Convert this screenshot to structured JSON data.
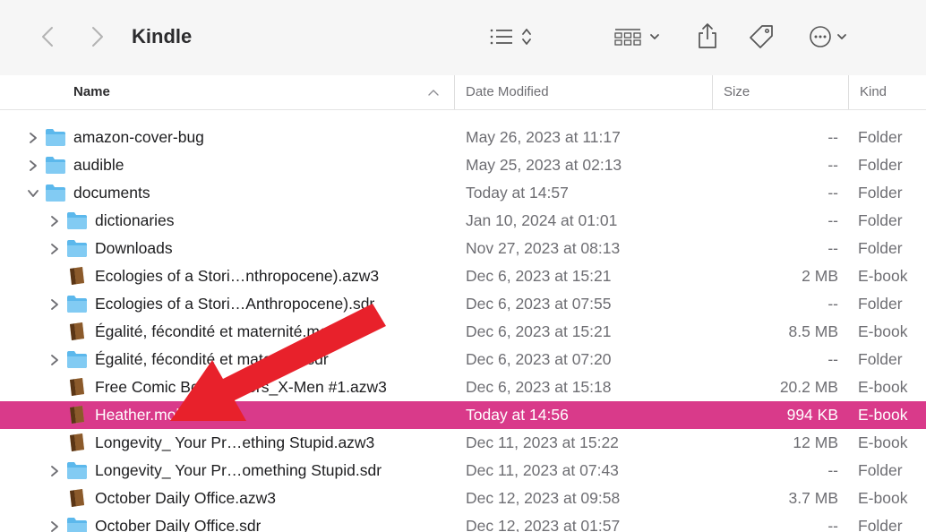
{
  "window": {
    "title": "Kindle"
  },
  "toolbar": {
    "back_icon": "chevron-left-icon",
    "forward_icon": "chevron-right-icon",
    "view_list_icon": "list-view-icon",
    "view_grid_icon": "grid-view-icon",
    "share_icon": "share-icon",
    "tag_icon": "tag-icon",
    "more_icon": "ellipsis-circle-icon"
  },
  "columns": {
    "name": "Name",
    "date": "Date Modified",
    "size": "Size",
    "kind": "Kind"
  },
  "colors": {
    "selection": "#d93a8a",
    "folder": "#5cb8ec",
    "ebook": "#8b5a2b",
    "arrow": "#e8212b"
  },
  "rows": [
    {
      "level": 0,
      "expand": "collapsed",
      "type": "folder",
      "name": "amazon-cover-bug",
      "date": "May 26, 2023 at 11:17",
      "size": "--",
      "kind": "Folder"
    },
    {
      "level": 0,
      "expand": "collapsed",
      "type": "folder",
      "name": "audible",
      "date": "May 25, 2023 at 02:13",
      "size": "--",
      "kind": "Folder"
    },
    {
      "level": 0,
      "expand": "expanded",
      "type": "folder",
      "name": "documents",
      "date": "Today at 14:57",
      "size": "--",
      "kind": "Folder"
    },
    {
      "level": 1,
      "expand": "collapsed",
      "type": "folder",
      "name": "dictionaries",
      "date": "Jan 10, 2024 at 01:01",
      "size": "--",
      "kind": "Folder"
    },
    {
      "level": 1,
      "expand": "collapsed",
      "type": "folder",
      "name": "Downloads",
      "date": "Nov 27, 2023 at 08:13",
      "size": "--",
      "kind": "Folder"
    },
    {
      "level": 1,
      "expand": "none",
      "type": "ebook",
      "name": "Ecologies of a Stori…nthropocene).azw3",
      "date": "Dec 6, 2023 at 15:21",
      "size": "2 MB",
      "kind": "E-book"
    },
    {
      "level": 1,
      "expand": "collapsed",
      "type": "folder",
      "name": "Ecologies of a Stori…Anthropocene).sdr",
      "date": "Dec 6, 2023 at 07:55",
      "size": "--",
      "kind": "Folder"
    },
    {
      "level": 1,
      "expand": "none",
      "type": "ebook",
      "name": "Égalité, fécondité et maternité.mobi",
      "date": "Dec 6, 2023 at 15:21",
      "size": "8.5 MB",
      "kind": "E-book"
    },
    {
      "level": 1,
      "expand": "collapsed",
      "type": "folder",
      "name": "Égalité, fécondité et maternité.sdr",
      "date": "Dec 6, 2023 at 07:20",
      "size": "--",
      "kind": "Folder"
    },
    {
      "level": 1,
      "expand": "none",
      "type": "ebook",
      "name": "Free Comic Book D…ers_X-Men #1.azw3",
      "date": "Dec 6, 2023 at 15:18",
      "size": "20.2 MB",
      "kind": "E-book"
    },
    {
      "level": 1,
      "expand": "none",
      "type": "ebook",
      "name": "Heather.mobi",
      "date": "Today at 14:56",
      "size": "994 KB",
      "kind": "E-book",
      "selected": true
    },
    {
      "level": 1,
      "expand": "none",
      "type": "ebook",
      "name": "Longevity_ Your Pr…ething Stupid.azw3",
      "date": "Dec 11, 2023 at 15:22",
      "size": "12 MB",
      "kind": "E-book"
    },
    {
      "level": 1,
      "expand": "collapsed",
      "type": "folder",
      "name": "Longevity_ Your Pr…omething Stupid.sdr",
      "date": "Dec 11, 2023 at 07:43",
      "size": "--",
      "kind": "Folder"
    },
    {
      "level": 1,
      "expand": "none",
      "type": "ebook",
      "name": "October Daily Office.azw3",
      "date": "Dec 12, 2023 at 09:58",
      "size": "3.7 MB",
      "kind": "E-book"
    },
    {
      "level": 1,
      "expand": "collapsed",
      "type": "folder",
      "name": "October Daily Office.sdr",
      "date": "Dec 12, 2023 at 01:57",
      "size": "--",
      "kind": "Folder"
    }
  ]
}
